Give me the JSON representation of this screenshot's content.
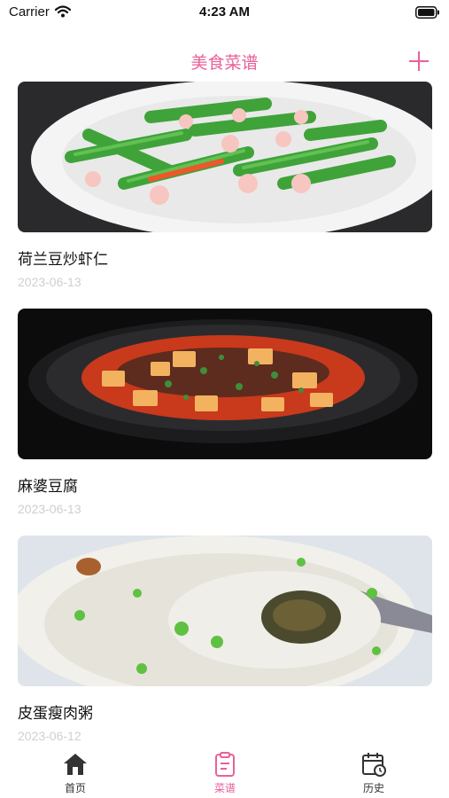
{
  "status": {
    "carrier": "Carrier",
    "time": "4:23 AM"
  },
  "nav": {
    "title": "美食菜谱"
  },
  "recipes": [
    {
      "name": "荷兰豆炒虾仁",
      "date": "2023-06-13"
    },
    {
      "name": "麻婆豆腐",
      "date": "2023-06-13"
    },
    {
      "name": "皮蛋瘦肉粥",
      "date": "2023-06-12"
    }
  ],
  "tabs": [
    {
      "label": "首页",
      "icon": "home-icon",
      "active": false
    },
    {
      "label": "菜谱",
      "icon": "recipe-icon",
      "active": true
    },
    {
      "label": "历史",
      "icon": "history-calendar-icon",
      "active": false
    }
  ],
  "colors": {
    "accent": "#e8609a",
    "date_text": "#cfcfcf",
    "tab_text": "#333333"
  }
}
